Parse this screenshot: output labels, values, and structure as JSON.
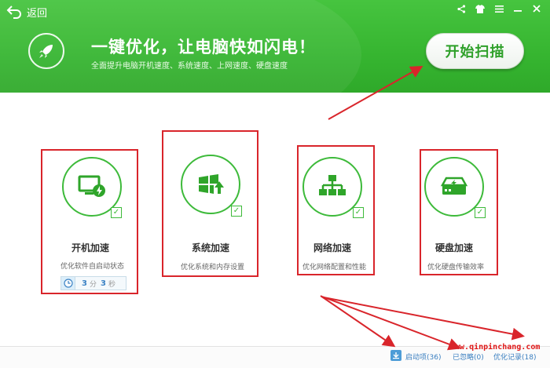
{
  "header": {
    "back_label": "返回",
    "title": "一键优化，让电脑快如闪电！",
    "subtitle": "全面提升电脑开机速度、系统速度、上网速度、硬盘速度",
    "scan_button": "开始扫描",
    "controls": [
      "share-icon",
      "skin-icon",
      "menu-icon",
      "minimize-icon",
      "close-icon"
    ]
  },
  "cards": [
    {
      "name": "开机加速",
      "desc": "优化软件自启动状态",
      "icon": "monitor-bolt-icon",
      "checked": true
    },
    {
      "name": "系统加速",
      "desc": "优化系统和内存设置",
      "icon": "windows-up-icon",
      "checked": true
    },
    {
      "name": "网络加速",
      "desc": "优化网络配置和性能",
      "icon": "network-icon",
      "checked": true
    },
    {
      "name": "硬盘加速",
      "desc": "优化硬盘传输效率",
      "icon": "harddisk-icon",
      "checked": true
    }
  ],
  "boot_timer": {
    "minutes": "3",
    "minute_unit": "分",
    "seconds": "3",
    "second_unit": "秒"
  },
  "footer": {
    "startup_items": "启动项(36)",
    "ignored": "已忽略(0)",
    "history": "优化记录(18)"
  },
  "watermark": "www.qinpinchang.com",
  "colors": {
    "brand_green": "#36b530",
    "annotation_red": "#d9252b",
    "link_blue": "#3a7fc0"
  }
}
